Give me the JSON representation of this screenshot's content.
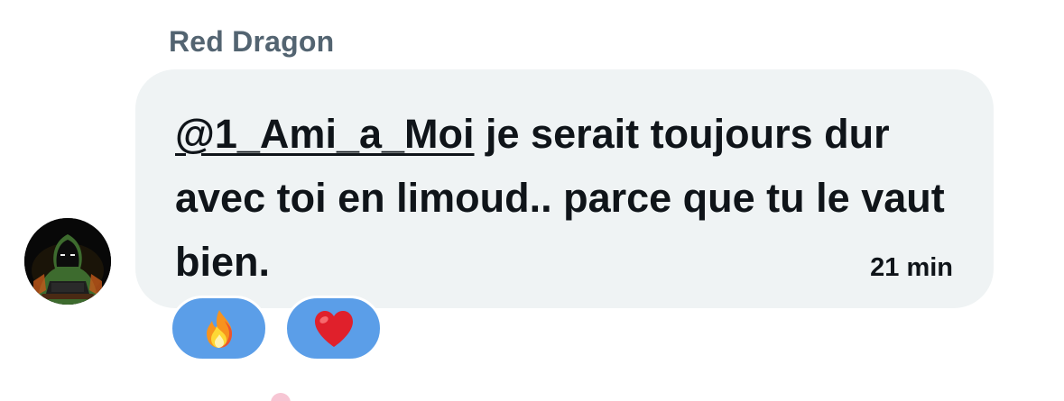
{
  "message": {
    "sender_name": "Red Dragon",
    "mention": "@1_Ami_a_Moi",
    "body_text": " je serait toujours dur avec toi en limoud.. parce que tu le vaut bien.",
    "timestamp": "21 min"
  },
  "avatar": {
    "icon": "hooded-hacker-avatar"
  },
  "reactions": [
    {
      "icon": "fire-emoji"
    },
    {
      "icon": "red-heart-emoji"
    }
  ],
  "colors": {
    "bubble_background": "#eff3f4",
    "sender_name": "#536471",
    "text": "#0f1419",
    "reaction_pill": "#5b9ee8"
  }
}
